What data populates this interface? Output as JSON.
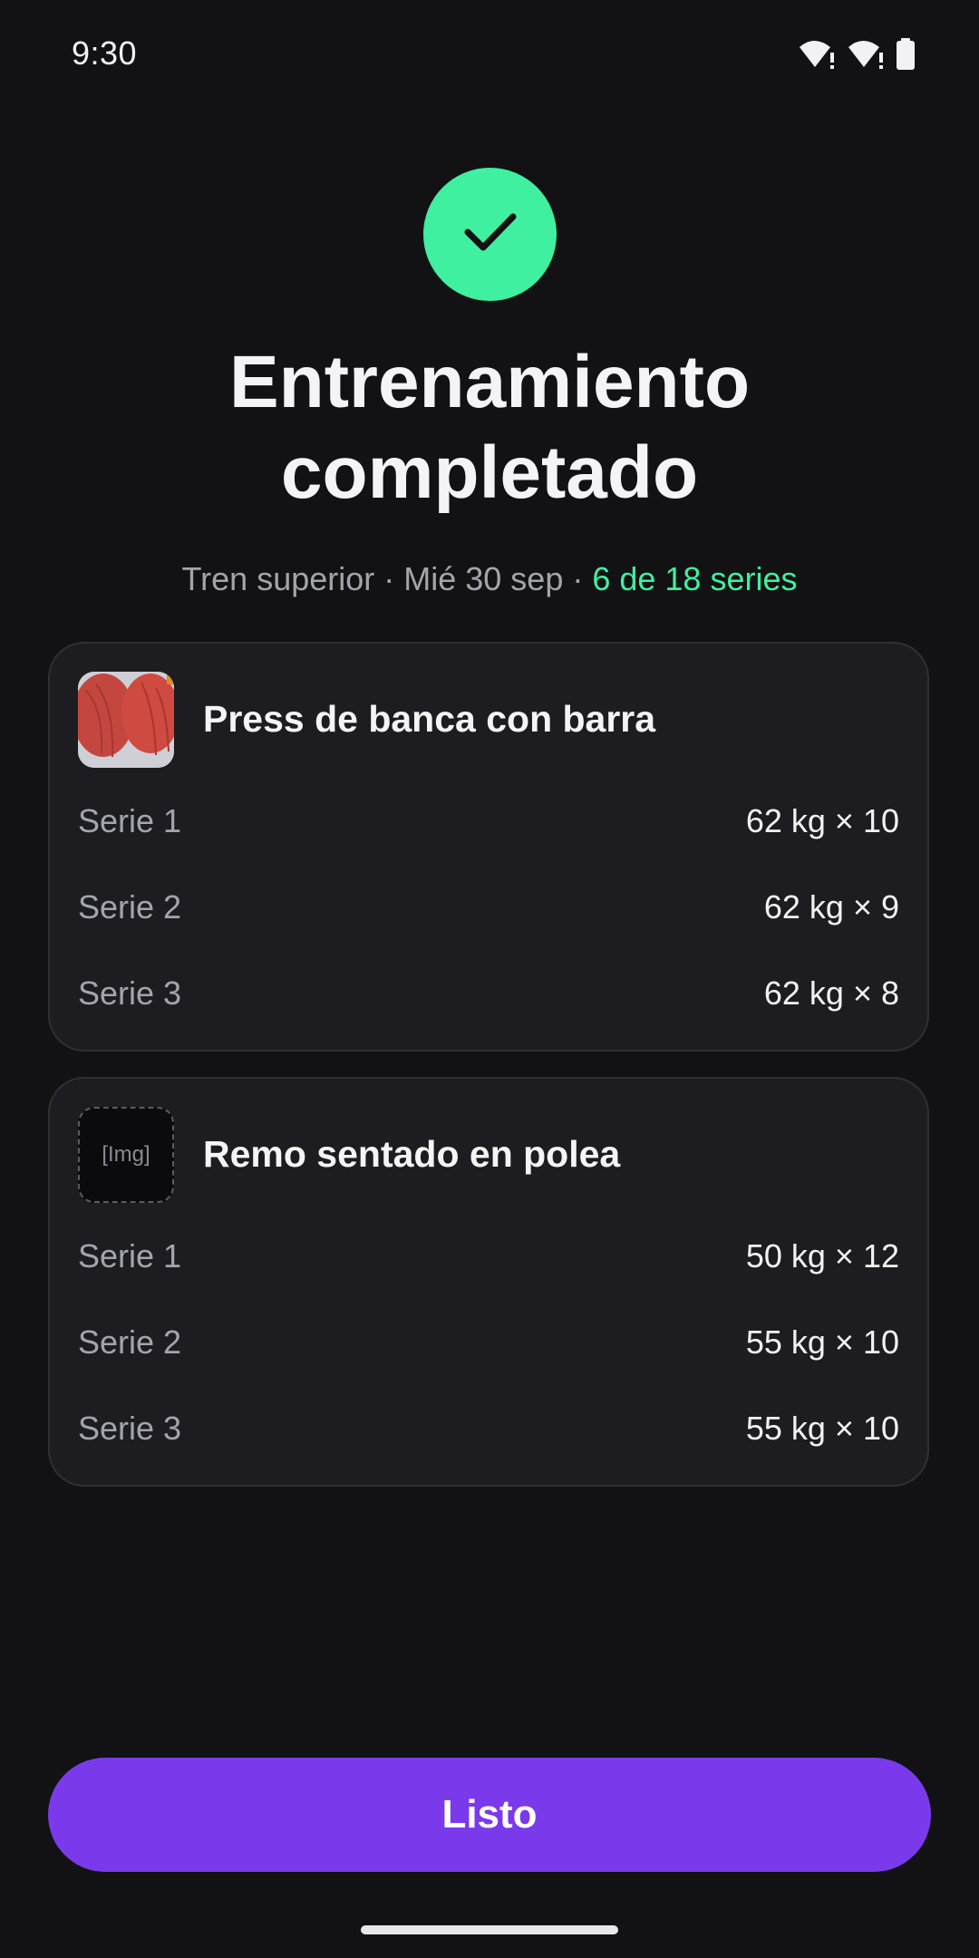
{
  "status_bar": {
    "time": "9:30",
    "icons": [
      "wifi-alert-icon",
      "wifi-alert-icon",
      "battery-icon"
    ]
  },
  "hero": {
    "icon": "check-icon",
    "title_line1": "Entrenamiento",
    "title_line2": "completado",
    "subtitle_prefix": "Tren superior · Mié 30 sep · ",
    "subtitle_accent": "6 de 18 series"
  },
  "exercises": [
    {
      "name": "Press de banca con barra",
      "thumbnail": "exercise-photo",
      "sets": [
        {
          "label": "Serie 1",
          "value": "62 kg × 10"
        },
        {
          "label": "Serie 2",
          "value": "62 kg × 9"
        },
        {
          "label": "Serie 3",
          "value": "62 kg × 8"
        }
      ]
    },
    {
      "name": "Remo sentado en polea",
      "thumbnail_placeholder": "[Img]",
      "sets": [
        {
          "label": "Serie 1",
          "value": "50 kg × 12"
        },
        {
          "label": "Serie 2",
          "value": "55 kg × 10"
        },
        {
          "label": "Serie 3",
          "value": "55 kg × 10"
        }
      ]
    }
  ],
  "done_button": {
    "label": "Listo"
  },
  "colors": {
    "background": "#121214",
    "card": "#1d1d21",
    "accent_green": "#3ef0a0",
    "button_purple": "#7a3aec",
    "muted_text": "#a4a4ac"
  }
}
